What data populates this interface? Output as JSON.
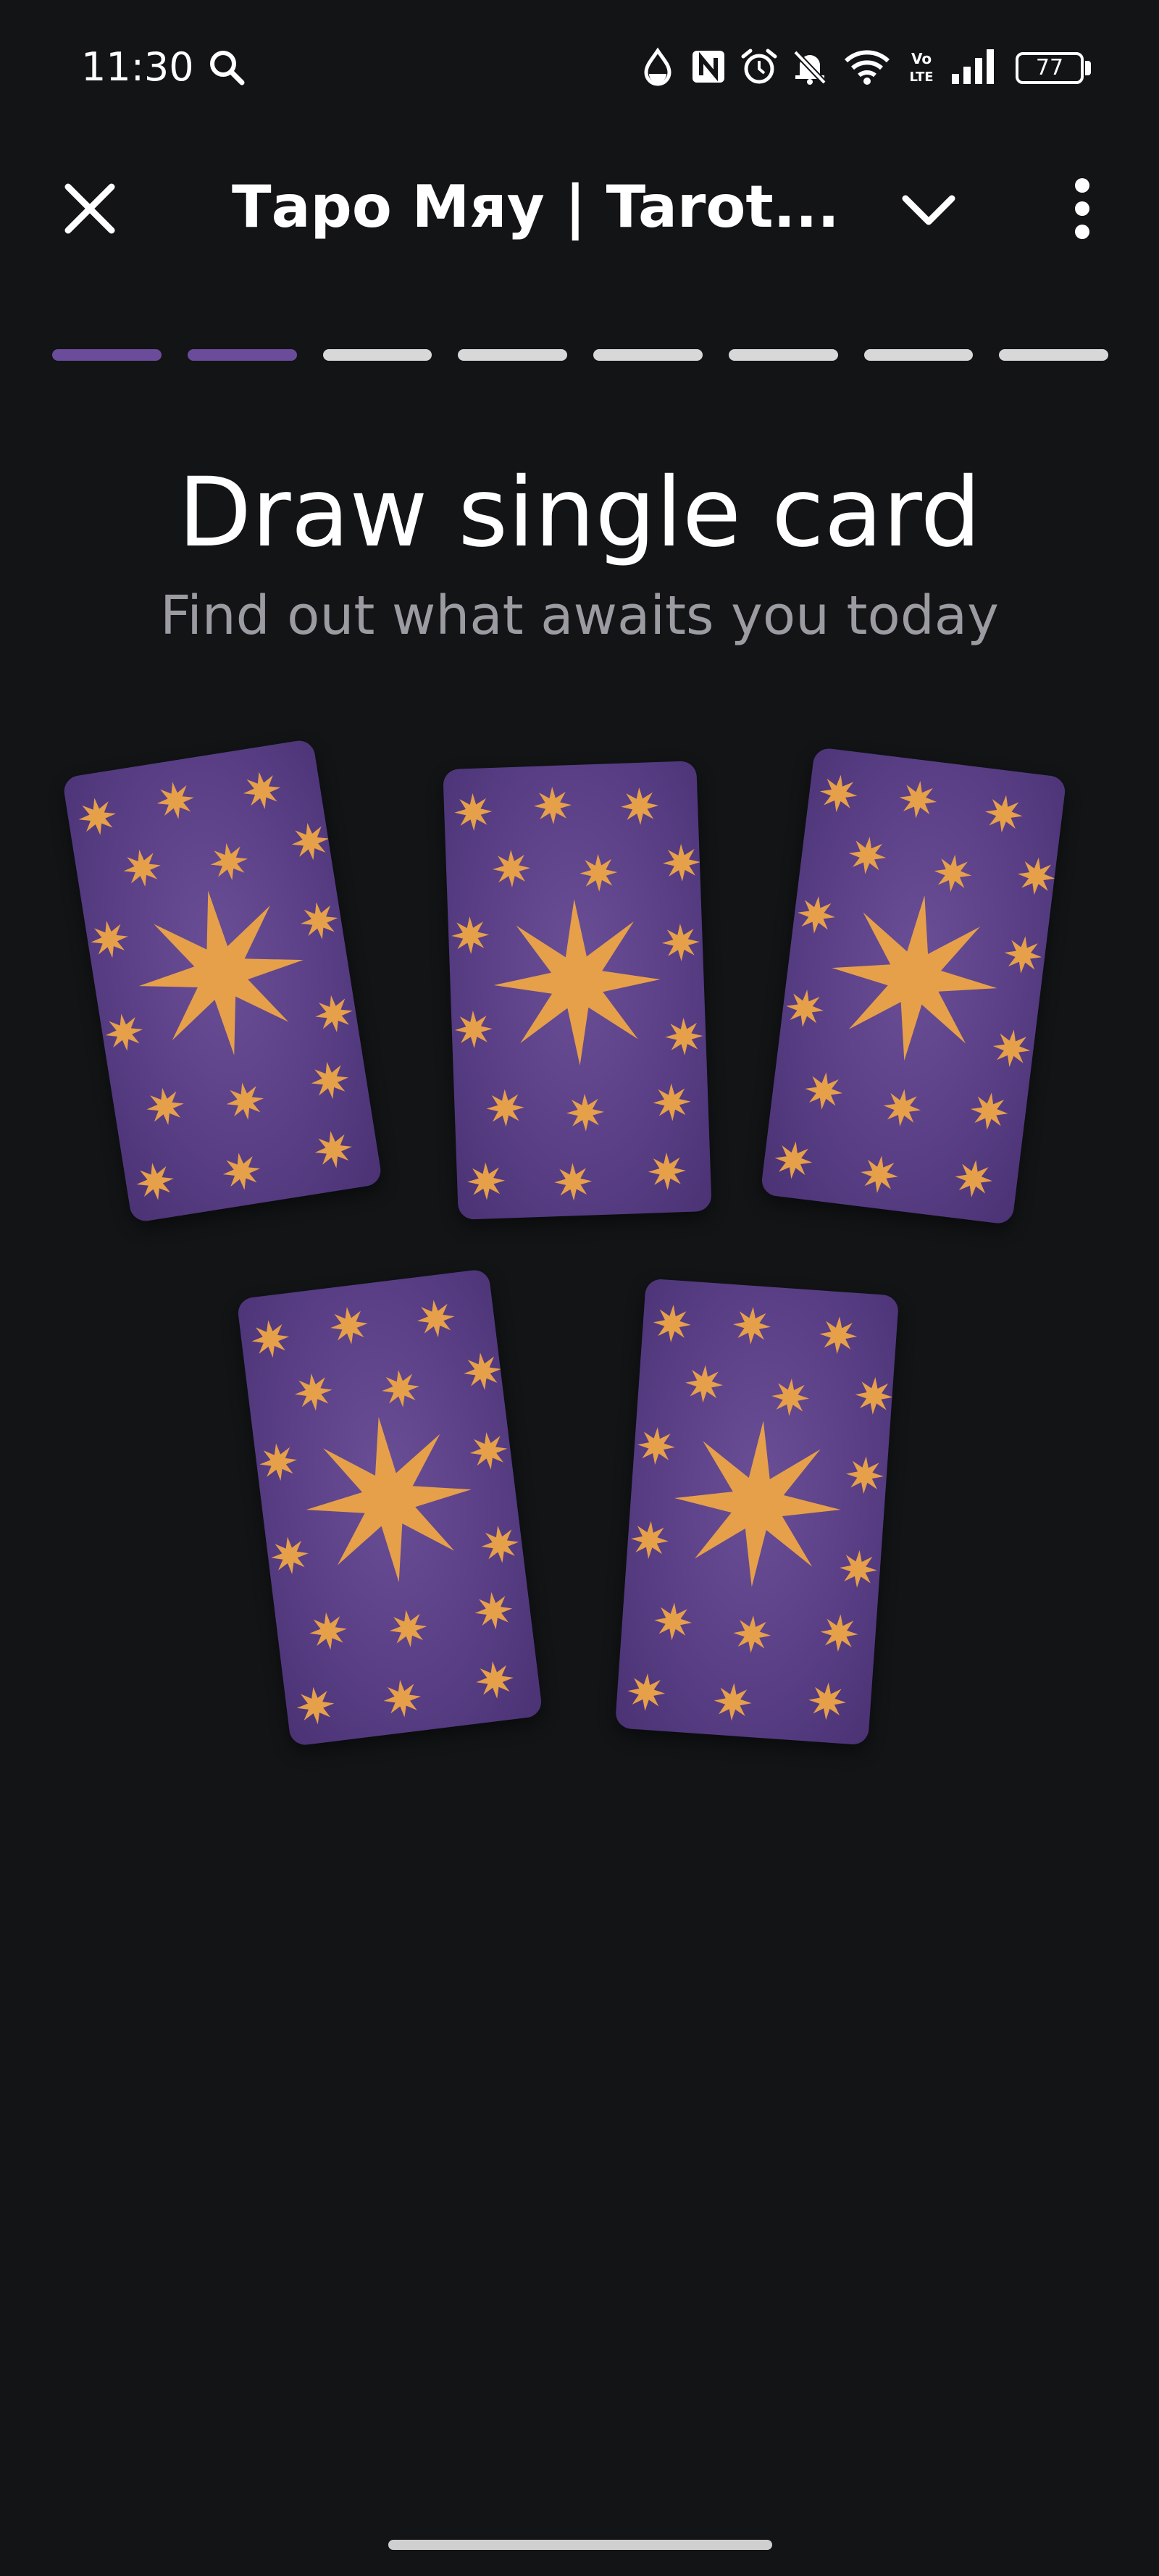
{
  "status_bar": {
    "time": "11:30",
    "battery_level": "77",
    "icons": [
      "search-icon",
      "data-saver-icon",
      "nfc-icon",
      "alarm-icon",
      "notifications-off-icon",
      "wifi-icon",
      "volte-icon",
      "signal-icon",
      "battery-icon"
    ]
  },
  "header": {
    "title": "Таро Мяу | Tarot..."
  },
  "progress": {
    "total_steps": 8,
    "completed_steps": 2
  },
  "content": {
    "title": "Draw single card",
    "subtitle": "Find out what awaits you today"
  },
  "cards": {
    "count": 5
  },
  "colors": {
    "background": "#121416",
    "progress_active": "#6a4c9a",
    "progress_inactive": "#d8d8d8",
    "card_purple": "#5a3f86",
    "card_star": "#e6a04a",
    "subtitle": "#9b9ba1"
  }
}
